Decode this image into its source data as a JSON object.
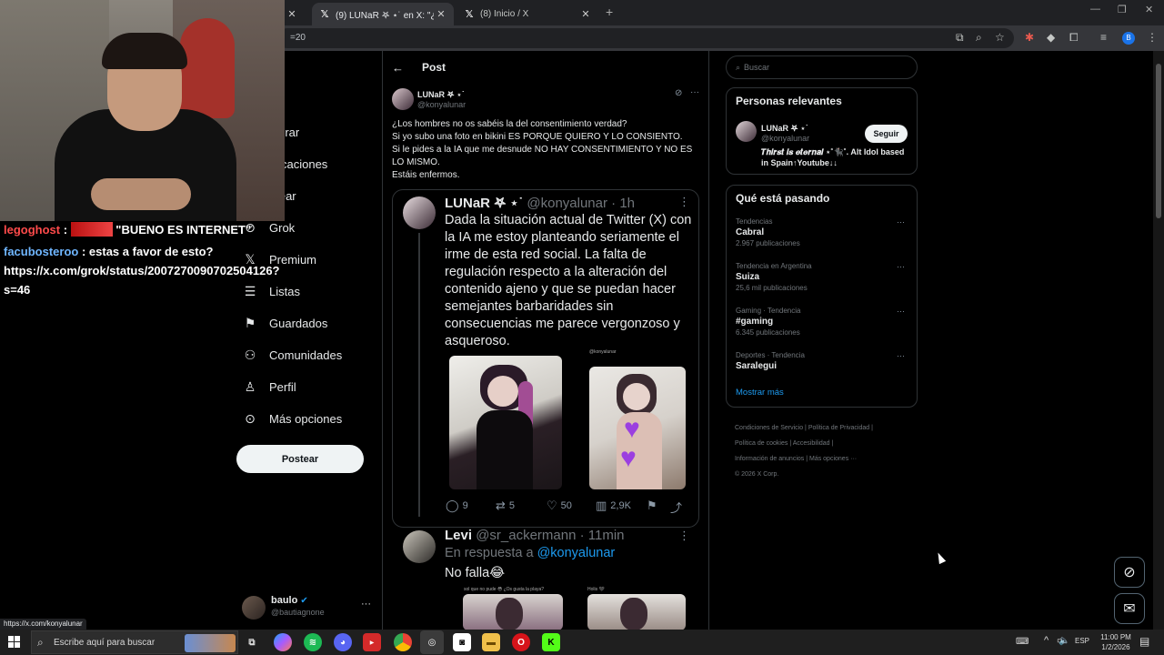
{
  "browser": {
    "tabs": [
      {
        "title": "",
        "active": false
      },
      {
        "title": "(9) LUNaR 𖤐 ⋆˙ en X: \"¿Los hom",
        "active": true
      },
      {
        "title": "(8) Inicio / X",
        "active": false
      }
    ],
    "url_fragment": "=20",
    "status_url": "https://x.com/konyalunar"
  },
  "nav": {
    "items": [
      {
        "label": "io",
        "icon": "home-icon"
      },
      {
        "label": "olorar",
        "icon": "search-icon"
      },
      {
        "label": "tificaciones",
        "icon": "bell-icon"
      },
      {
        "label": "atear",
        "icon": "chat-icon"
      },
      {
        "label": "Grok",
        "icon": "grok-icon"
      },
      {
        "label": "Premium",
        "icon": "x-logo-icon"
      },
      {
        "label": "Listas",
        "icon": "list-icon"
      },
      {
        "label": "Guardados",
        "icon": "bookmark-icon"
      },
      {
        "label": "Comunidades",
        "icon": "communities-icon"
      },
      {
        "label": "Perfil",
        "icon": "profile-icon"
      },
      {
        "label": "Más opciones",
        "icon": "more-circle-icon"
      }
    ],
    "post_button": "Postear",
    "account": {
      "name": "baulo",
      "handle": "@bautiagnone"
    }
  },
  "post": {
    "header": "Post",
    "author": "LUNaR 𖤐 ⋆˙",
    "handle": "@konyalunar",
    "text_lines": [
      "¿Los hombres no os sabéis la del consentimiento verdad?",
      "Si yo subo una foto en bikini ES PORQUE QUIERO Y LO CONSIENTO.",
      "Si le pides a la IA que me desnude NO HAY CONSENTIMIENTO Y NO ES",
      "LO MISMO.",
      "Estáis enfermos."
    ],
    "quoted": {
      "author": "LUNaR 𖤐 ⋆˙",
      "handle": "@konyalunar · 1h",
      "text": "Dada la situación actual de Twitter (X) con la IA me estoy planteando seriamente el irme de esta red social. La falta de regulación respecto a la alteración del contenido ajeno y que se puedan hacer semejantes barbaridades sin consecuencias me parece vergonzoso y asqueroso.",
      "image_caption": "@konyalunar"
    },
    "actions": {
      "replies": "9",
      "reposts": "5",
      "likes": "50",
      "views": "2,9K"
    }
  },
  "reply": {
    "author": "Levi",
    "handle": "@sr_ackermann · 11min",
    "in_reply_prefix": "En respuesta a",
    "in_reply_handle": "@konyalunar",
    "text": "No falla😂",
    "image_caption_1": "sol que no pude 😳 ¿Os gusta la playa?",
    "image_caption_2": "Holis 🖤"
  },
  "sidebar": {
    "search_placeholder": "Buscar",
    "relevant": {
      "title": "Personas relevantes",
      "name": "LUNaR 𖤐 ⋆˙",
      "handle": "@konyalunar",
      "follow": "Seguir",
      "bio": "𝑻𝒉𝒊𝒓𝒔𝒕 𝒊𝒔 𝒆𝒕𝒆𝒓𝒏𝒂𝒍 ⋆˚🐈‍⬛˚. Alt Idol based in Spain↑Youtube↓↓"
    },
    "trending": {
      "title": "Qué está pasando",
      "items": [
        {
          "meta": "Tendencias",
          "name": "Cabral",
          "count": "2.967 publicaciones"
        },
        {
          "meta": "Tendencia en Argentina",
          "name": "Suiza",
          "count": "25,6 mil publicaciones"
        },
        {
          "meta": "Gaming · Tendencia",
          "name": "#gaming",
          "count": "6.345 publicaciones"
        },
        {
          "meta": "Deportes · Tendencia",
          "name": "Saralegui",
          "count": ""
        }
      ],
      "show_more": "Mostrar más"
    },
    "footer": [
      "Condiciones de Servicio",
      "Política de Privacidad",
      "Política de cookies",
      "Accesibilidad",
      "Información de anuncios",
      "Más opciones ···",
      "© 2026 X Corp."
    ]
  },
  "stream_chat": {
    "line1_user": "legoghost",
    "line1_text": "\"BUENO ES INTERNET\"",
    "line2_user": "facubosteroo",
    "line2_text": ": estas a favor de esto?",
    "line3": "https://x.com/grok/status/2007270090702504126?",
    "line4": "s=46"
  },
  "taskbar": {
    "search_placeholder": "Escribe aquí para buscar",
    "lang": "ESP",
    "time": "11:00 PM",
    "date": "1/2/2026"
  },
  "colors": {
    "accent": "#1d9bf0",
    "border": "#2f3336",
    "muted": "#71767b"
  }
}
